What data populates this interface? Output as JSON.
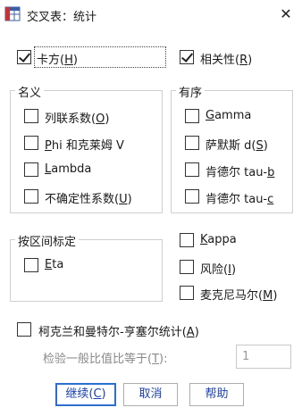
{
  "window": {
    "title": "交叉表：统计",
    "close_glyph": "✕"
  },
  "top": {
    "chisq": {
      "label": "卡方",
      "key": "H",
      "checked": true
    },
    "corr": {
      "label": "相关性",
      "key": "R",
      "checked": true
    }
  },
  "nominal": {
    "title": "名义",
    "items": [
      {
        "label": "列联系数",
        "key": "O",
        "post": ""
      },
      {
        "label": "",
        "key": "P",
        "post": "hi 和克莱姆 V"
      },
      {
        "label": "",
        "key": "L",
        "post": "ambda"
      },
      {
        "label": "不确定性系数",
        "key": "U",
        "post": ""
      }
    ]
  },
  "ordinal": {
    "title": "有序",
    "items": [
      {
        "label": "",
        "key": "G",
        "post": "amma"
      },
      {
        "label": "萨默斯 d",
        "key": "S",
        "post": ""
      },
      {
        "label": "肯德尔 tau-",
        "key": "b",
        "post": ""
      },
      {
        "label": "肯德尔 tau-",
        "key": "c",
        "post": ""
      }
    ]
  },
  "interval": {
    "title": "按区间标定",
    "eta": {
      "key": "E",
      "post": "ta"
    }
  },
  "right": {
    "kappa": {
      "key": "K",
      "post": "appa"
    },
    "risk": {
      "label": "风险",
      "key": "I"
    },
    "mcnemar": {
      "label": "麦克尼马尔",
      "key": "M"
    }
  },
  "cmh": {
    "label": "柯克兰和曼特尔-亨塞尔统计",
    "key": "A"
  },
  "test": {
    "label": "检验一般比值比等于",
    "key": "T",
    "value": "1"
  },
  "buttons": {
    "continue": {
      "label": "继续",
      "key": "C"
    },
    "cancel": "取消",
    "help": "帮助"
  }
}
